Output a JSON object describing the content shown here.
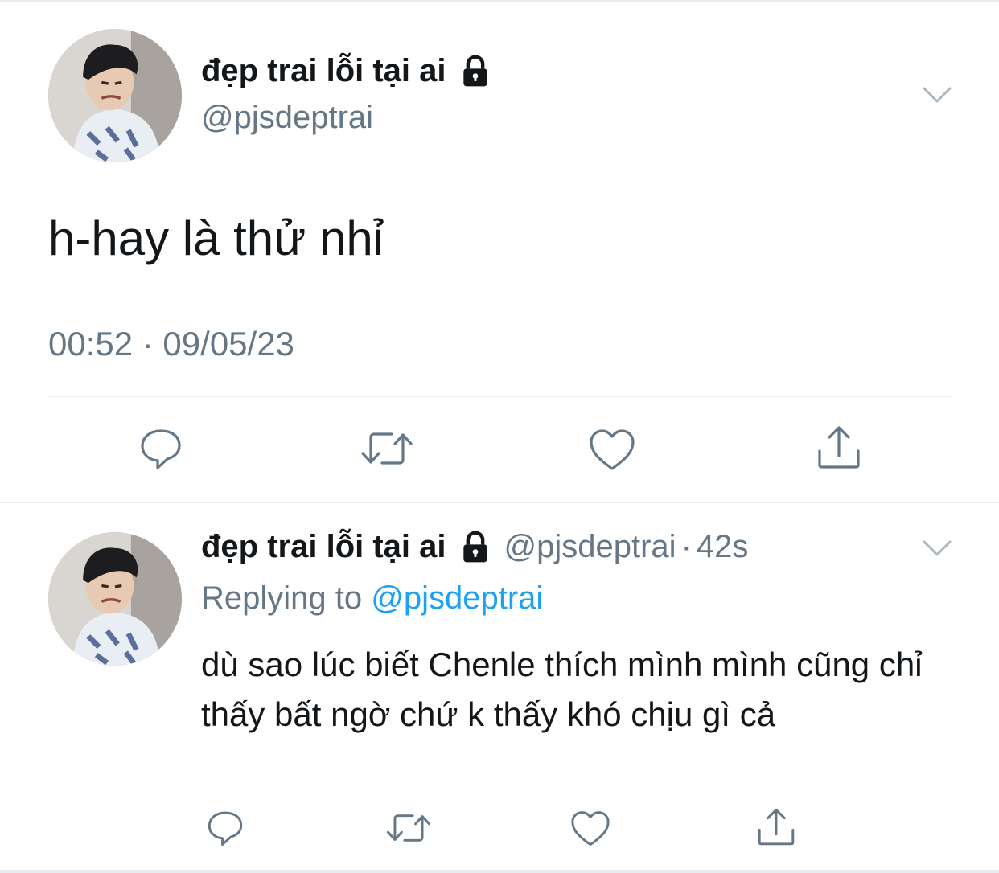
{
  "main_tweet": {
    "display_name": "đẹp trai lỗi tại ai",
    "handle": "@pjsdeptrai",
    "text": "h-hay là thử nhỉ",
    "timestamp": "00:52 · 09/05/23",
    "protected_icon": "lock-icon",
    "menu_icon": "chevron-down-icon"
  },
  "reply_tweet": {
    "display_name": "đẹp trai lỗi tại ai",
    "handle": "@pjsdeptrai",
    "separator": "·",
    "age": "42s",
    "replying_prefix": "Replying to",
    "replying_to": "@pjsdeptrai",
    "text": "dù sao lúc biết Chenle thích mình mình cũng chỉ thấy bất ngờ chứ k thấy khó chịu gì cả"
  },
  "actions": [
    "reply-icon",
    "retweet-icon",
    "like-icon",
    "share-icon"
  ],
  "colors": {
    "text_primary": "#14171a",
    "text_secondary": "#657786",
    "link": "#1da1f2",
    "divider": "#e6ecf0"
  }
}
